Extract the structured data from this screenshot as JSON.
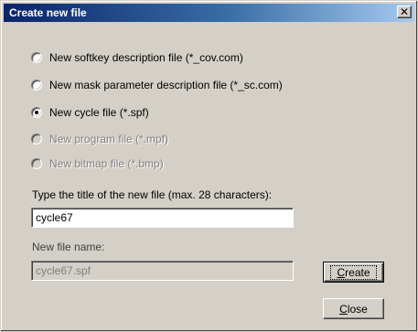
{
  "window": {
    "title": "Create new file",
    "close_glyph": "✕"
  },
  "options": [
    {
      "label": "New softkey description file (*_cov.com)",
      "checked": false,
      "enabled": true
    },
    {
      "label": "New mask parameter description file (*_sc.com)",
      "checked": false,
      "enabled": true
    },
    {
      "label": "New cycle file (*.spf)",
      "checked": true,
      "enabled": true
    },
    {
      "label": "New program file (*.mpf)",
      "checked": false,
      "enabled": false
    },
    {
      "label": "New bitmap file (*.bmp)",
      "checked": false,
      "enabled": false
    }
  ],
  "title_field": {
    "label": "Type the title of the new file (max. 28 characters):",
    "value": "cycle67"
  },
  "filename_field": {
    "label": "New file name:",
    "value": "cycle67.spf"
  },
  "buttons": {
    "create_first": "C",
    "create_rest": "reate",
    "close_first": "C",
    "close_rest": "lose"
  }
}
